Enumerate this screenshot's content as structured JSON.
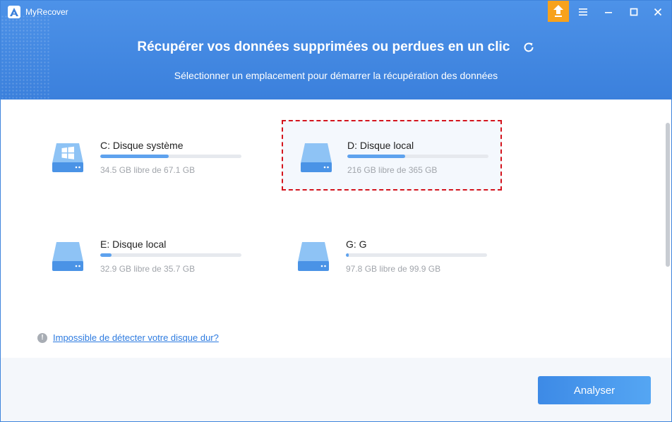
{
  "app": {
    "title": "MyRecover"
  },
  "header": {
    "title": "Récupérer vos données supprimées ou perdues en un clic",
    "subtitle": "Sélectionner un emplacement pour démarrer la récupération des données"
  },
  "drives": [
    {
      "name": "C: Disque système",
      "free_text": "34.5 GB libre de 67.1 GB",
      "used_fraction": 0.486,
      "icon": "windows-system-drive-icon",
      "selected": false
    },
    {
      "name": "D: Disque local",
      "free_text": "216 GB libre de 365 GB",
      "used_fraction": 0.408,
      "icon": "hard-drive-icon",
      "selected": true
    },
    {
      "name": "E: Disque local",
      "free_text": "32.9 GB libre de 35.7 GB",
      "used_fraction": 0.078,
      "icon": "hard-drive-icon",
      "selected": false
    },
    {
      "name": "G: G",
      "free_text": "97.8 GB libre de 99.9 GB",
      "used_fraction": 0.021,
      "icon": "hard-drive-icon",
      "selected": false
    }
  ],
  "help": {
    "link_text": "Impossible de détecter votre disque dur?"
  },
  "footer": {
    "analyze_label": "Analyser"
  },
  "colors": {
    "header": "#3f86e0",
    "accent": "#3d8ae6",
    "upgrade": "#f7a21c",
    "selection_border": "#d4141d",
    "progress_fill": "#5ea2ee"
  }
}
